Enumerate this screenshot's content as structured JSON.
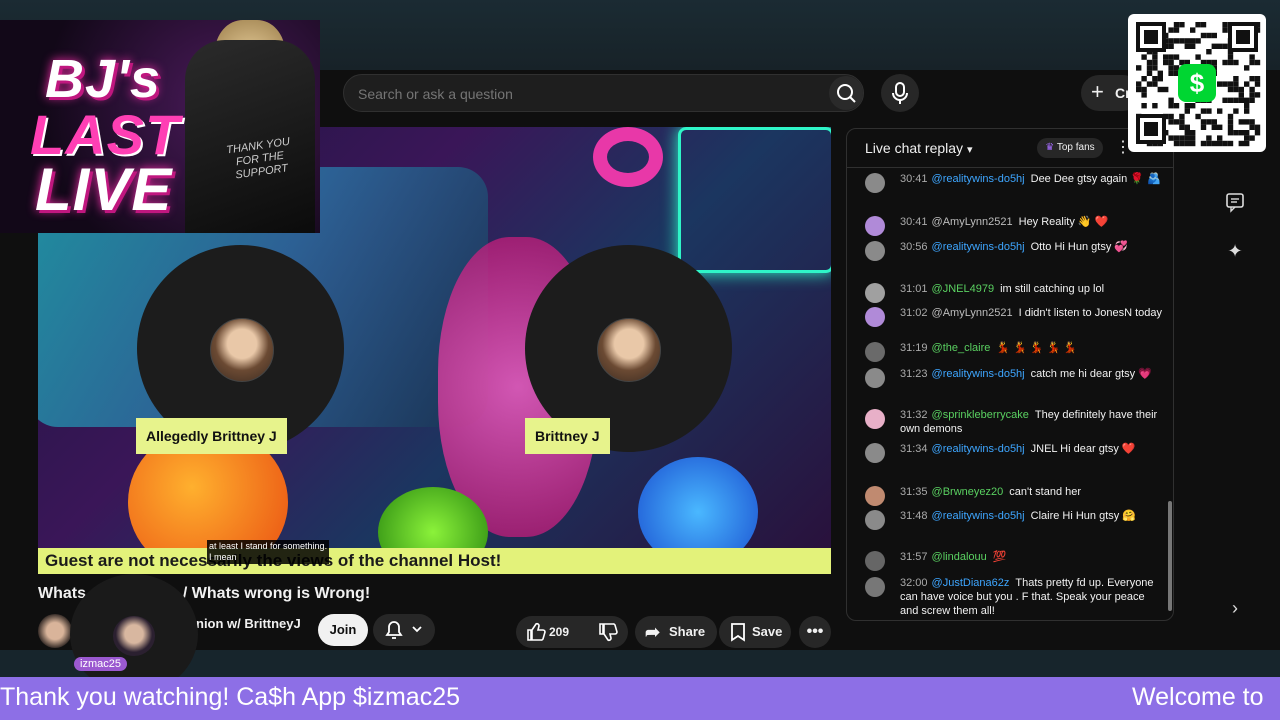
{
  "logo": {
    "line1": "BJ's",
    "line2": "LAST",
    "line3": "LIVE",
    "jacket_text": "THANK YOU FOR THE SUPPORT"
  },
  "search": {
    "placeholder": "Search or ask a question"
  },
  "header": {
    "create_label": "Cr"
  },
  "video": {
    "guests": [
      {
        "name": "Allegedly Brittney J"
      },
      {
        "name": "Brittney J"
      }
    ],
    "disclaimer": "Guest are not necessarily the views of the channel Host!",
    "caption_line1": "at least I stand for something.",
    "caption_line2": "I mean"
  },
  "title": {
    "part1": "Whats",
    "part2": "/ Whats wrong is Wrong!"
  },
  "channel": {
    "name": "nion w/ BrittneyJ",
    "join_label": "Join",
    "overlay_badge": "izmac25"
  },
  "actions": {
    "likes": "209",
    "share_label": "Share",
    "save_label": "Save"
  },
  "chat": {
    "title": "Live chat replay",
    "top_fans_label": "Top fans",
    "messages": [
      {
        "time": "30:41",
        "author": "@realitywins-do5hj",
        "style": "blue",
        "text": "Dee Dee gtsy again 🌹 🫂"
      },
      {
        "time": "30:41",
        "author": "@AmyLynn2521",
        "style": "plain",
        "text": "Hey Reality 👋 ❤️"
      },
      {
        "time": "30:56",
        "author": "@realitywins-do5hj",
        "style": "blue",
        "text": "Otto Hi Hun gtsy 💞"
      },
      {
        "time": "31:01",
        "author": "@JNEL4979",
        "style": "green",
        "text": "im still catching up lol"
      },
      {
        "time": "31:02",
        "author": "@AmyLynn2521",
        "style": "plain",
        "text": "I didn't listen to JonesN today"
      },
      {
        "time": "31:19",
        "author": "@the_claire",
        "style": "green",
        "text": "💃 💃 💃 💃 💃"
      },
      {
        "time": "31:23",
        "author": "@realitywins-do5hj",
        "style": "blue",
        "text": "catch me hi dear gtsy 💗"
      },
      {
        "time": "31:32",
        "author": "@sprinkleberrycake",
        "style": "green",
        "text": "They definitely have their own demons"
      },
      {
        "time": "31:34",
        "author": "@realitywins-do5hj",
        "style": "blue",
        "text": "JNEL Hi dear gtsy ❤️"
      },
      {
        "time": "31:35",
        "author": "@Brwneyez20",
        "style": "green",
        "text": "can't stand her"
      },
      {
        "time": "31:48",
        "author": "@realitywins-do5hj",
        "style": "blue",
        "text": "Claire Hi Hun gtsy 🤗"
      },
      {
        "time": "31:57",
        "author": "@lindalouu",
        "style": "green",
        "text": "💯"
      },
      {
        "time": "32:00",
        "author": "@JustDiana62z",
        "style": "blue",
        "text": "Thats pretty fd up. Everyone can have voice but you . F that. Speak your peace and screw them all!"
      }
    ]
  },
  "ticker": {
    "left": "Thank you watching! Ca$h App $izmac25",
    "right": "Welcome to"
  },
  "qr": {
    "cash_symbol": "$"
  },
  "colors": {
    "accent_label": "#e7f38c",
    "ticker_bg": "#8d6fe6",
    "chat_green": "#5ad161",
    "chat_blue": "#3ea6ff"
  }
}
